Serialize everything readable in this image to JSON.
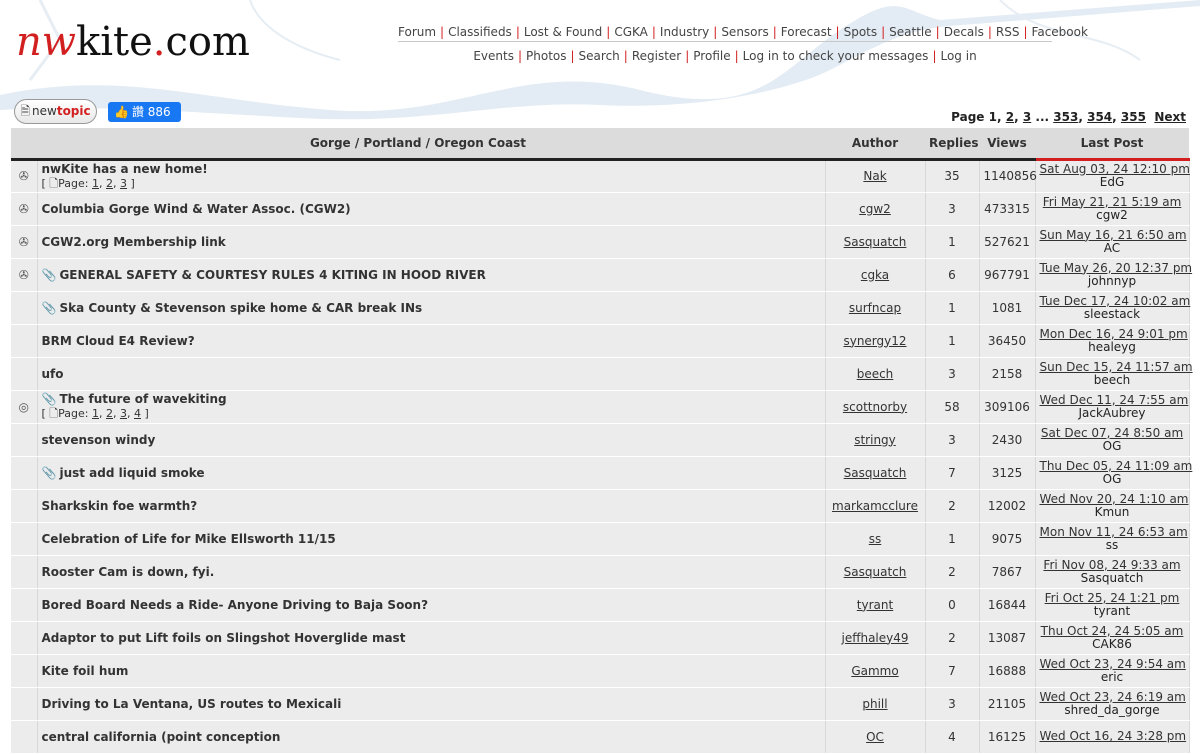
{
  "logo": {
    "part1": "nw",
    "part2": "kite",
    "part3": ".",
    "part4": "com"
  },
  "nav": {
    "row1": [
      "Forum",
      "Classifieds",
      "Lost & Found",
      "CGKA",
      "Industry",
      "Sensors",
      "Forecast",
      "Spots",
      "Seattle",
      "Decals",
      "RSS",
      "Facebook"
    ],
    "row2": [
      "Events",
      "Photos",
      "Search",
      "Register",
      "Profile",
      "Log in to check your messages",
      "Log in"
    ]
  },
  "new_topic": {
    "part1": "new",
    "part2": "topic",
    "icon": "document-pencil-icon"
  },
  "facebook_like": {
    "label": "讚 886",
    "icon": "thumbs-up-icon"
  },
  "pagination": {
    "prefix": "Page",
    "current": "1",
    "pages_a": [
      "2",
      "3"
    ],
    "ellipsis": "...",
    "pages_b": [
      "353",
      "354",
      "355"
    ],
    "next": "Next"
  },
  "table": {
    "headers": {
      "topic": "Gorge / Portland / Oregon Coast",
      "author": "Author",
      "replies": "Replies",
      "views": "Views",
      "last_post": "Last Post"
    },
    "page_prefix": "Page:",
    "rows": [
      {
        "icon": "announcement-icon",
        "attach": false,
        "title": "nwKite has a new home!",
        "pages": [
          "1",
          "2",
          "3"
        ],
        "author": "Nak",
        "replies": "35",
        "views": "1140856",
        "last_date": "Sat Aug 03, 24 12:10 pm",
        "last_user": "EdG"
      },
      {
        "icon": "announcement-icon",
        "attach": false,
        "title": "Columbia Gorge Wind & Water Assoc. (CGW2)",
        "pages": [],
        "author": "cgw2",
        "replies": "3",
        "views": "473315",
        "last_date": "Fri May 21, 21 5:19 am",
        "last_user": "cgw2"
      },
      {
        "icon": "announcement-icon",
        "attach": false,
        "title": "CGW2.org Membership link",
        "pages": [],
        "author": "Sasquatch",
        "replies": "1",
        "views": "527621",
        "last_date": "Sun May 16, 21 6:50 am",
        "last_user": "AC"
      },
      {
        "icon": "announcement-icon",
        "attach": true,
        "title": "GENERAL SAFETY & COURTESY RULES 4 KITING IN HOOD RIVER",
        "pages": [],
        "author": "cgka",
        "replies": "6",
        "views": "967791",
        "last_date": "Tue May 26, 20 12:37 pm",
        "last_user": "johnnyp"
      },
      {
        "icon": "",
        "attach": true,
        "title": "Ska County & Stevenson spike home & CAR break INs",
        "pages": [],
        "author": "surfncap",
        "replies": "1",
        "views": "1081",
        "last_date": "Tue Dec 17, 24 10:02 am",
        "last_user": "sleestack"
      },
      {
        "icon": "",
        "attach": false,
        "title": "BRM Cloud E4 Review?",
        "pages": [],
        "author": "synergy12",
        "replies": "1",
        "views": "36450",
        "last_date": "Mon Dec 16, 24 9:01 pm",
        "last_user": "healeyg"
      },
      {
        "icon": "",
        "attach": false,
        "title": "ufo",
        "pages": [],
        "author": "beech",
        "replies": "3",
        "views": "2158",
        "last_date": "Sun Dec 15, 24 11:57 am",
        "last_user": "beech"
      },
      {
        "icon": "hot-topic-icon",
        "attach": true,
        "title": "The future of wavekiting",
        "pages": [
          "1",
          "2",
          "3",
          "4"
        ],
        "author": "scottnorby",
        "replies": "58",
        "views": "309106",
        "last_date": "Wed Dec 11, 24 7:55 am",
        "last_user": "JackAubrey"
      },
      {
        "icon": "",
        "attach": false,
        "title": "stevenson windy",
        "pages": [],
        "author": "stringy",
        "replies": "3",
        "views": "2430",
        "last_date": "Sat Dec 07, 24 8:50 am",
        "last_user": "OG"
      },
      {
        "icon": "",
        "attach": true,
        "title": "just add liquid smoke",
        "pages": [],
        "author": "Sasquatch",
        "replies": "7",
        "views": "3125",
        "last_date": "Thu Dec 05, 24 11:09 am",
        "last_user": "OG"
      },
      {
        "icon": "",
        "attach": false,
        "title": "Sharkskin foe warmth?",
        "pages": [],
        "author": "markamcclure",
        "replies": "2",
        "views": "12002",
        "last_date": "Wed Nov 20, 24 1:10 am",
        "last_user": "Kmun"
      },
      {
        "icon": "",
        "attach": false,
        "title": "Celebration of Life for Mike Ellsworth 11/15",
        "pages": [],
        "author": "ss",
        "replies": "1",
        "views": "9075",
        "last_date": "Mon Nov 11, 24 6:53 am",
        "last_user": "ss"
      },
      {
        "icon": "",
        "attach": false,
        "title": "Rooster Cam is down, fyi.",
        "pages": [],
        "author": "Sasquatch",
        "replies": "2",
        "views": "7867",
        "last_date": "Fri Nov 08, 24 9:33 am",
        "last_user": "Sasquatch"
      },
      {
        "icon": "",
        "attach": false,
        "title": "Bored Board Needs a Ride- Anyone Driving to Baja Soon?",
        "pages": [],
        "author": "tyrant",
        "replies": "0",
        "views": "16844",
        "last_date": "Fri Oct 25, 24 1:21 pm",
        "last_user": "tyrant"
      },
      {
        "icon": "",
        "attach": false,
        "title": "Adaptor to put Lift foils on Slingshot Hoverglide mast",
        "pages": [],
        "author": "jeffhaley49",
        "replies": "2",
        "views": "13087",
        "last_date": "Thu Oct 24, 24 5:05 am",
        "last_user": "CAK86"
      },
      {
        "icon": "",
        "attach": false,
        "title": "Kite foil hum",
        "pages": [],
        "author": "Gammo",
        "replies": "7",
        "views": "16888",
        "last_date": "Wed Oct 23, 24 9:54 am",
        "last_user": "eric"
      },
      {
        "icon": "",
        "attach": false,
        "title": "Driving to La Ventana, US routes to Mexicali",
        "pages": [],
        "author": "phill",
        "replies": "3",
        "views": "21105",
        "last_date": "Wed Oct 23, 24 6:19 am",
        "last_user": "shred_da_gorge"
      },
      {
        "icon": "",
        "attach": false,
        "title": "central california (point conception",
        "pages": [],
        "author": "OC",
        "replies": "4",
        "views": "16125",
        "last_date": "Wed Oct 16, 24 3:28 pm",
        "last_user": ""
      }
    ]
  },
  "colors": {
    "accent": "#d21f1f",
    "header_bg": "#dcdcdc",
    "row_bg": "#ececec",
    "facebook": "#1877f2"
  }
}
